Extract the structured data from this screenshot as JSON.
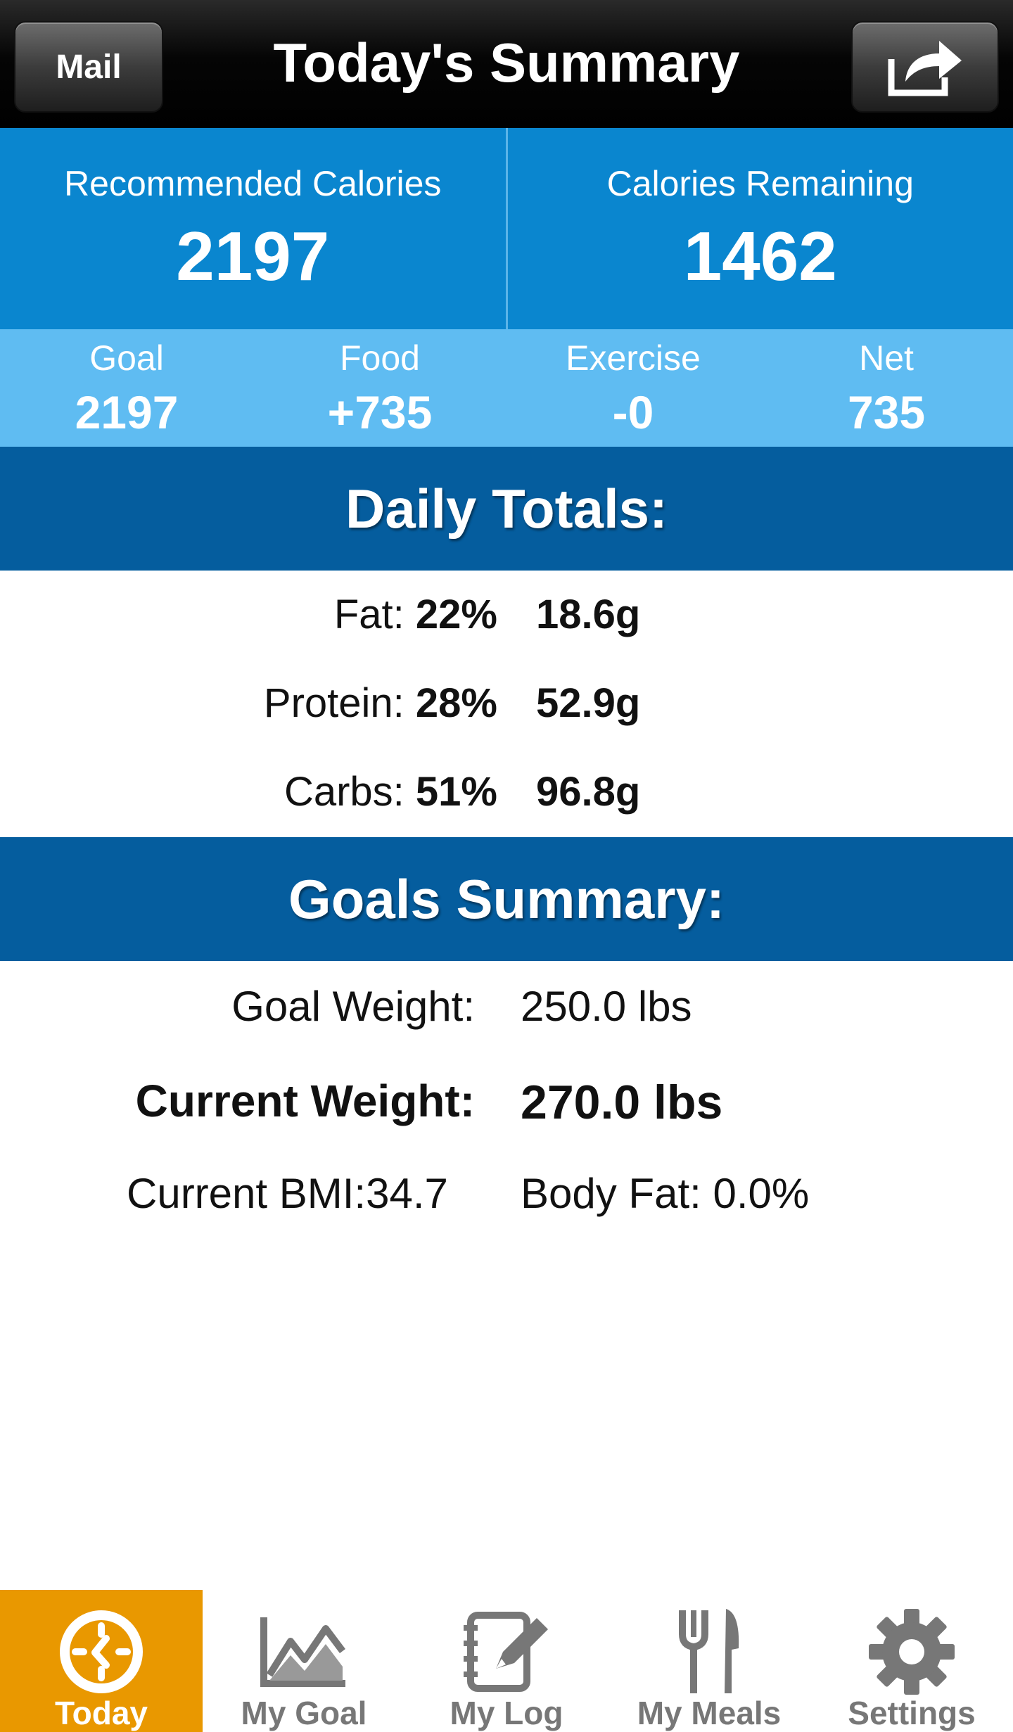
{
  "header": {
    "mail_label": "Mail",
    "title": "Today's Summary",
    "share_icon": "share-icon"
  },
  "calories": {
    "recommended_label": "Recommended Calories",
    "recommended_value": "2197",
    "remaining_label": "Calories Remaining",
    "remaining_value": "1462"
  },
  "breakdown": [
    {
      "label": "Goal",
      "value": "2197"
    },
    {
      "label": "Food",
      "value": "+735"
    },
    {
      "label": "Exercise",
      "value": "-0"
    },
    {
      "label": "Net",
      "value": "735"
    }
  ],
  "daily_totals": {
    "title": "Daily Totals:",
    "rows": [
      {
        "name": "Fat:",
        "percent": "22%",
        "grams": "18.6g"
      },
      {
        "name": "Protein:",
        "percent": "28%",
        "grams": "52.9g"
      },
      {
        "name": "Carbs:",
        "percent": "51%",
        "grams": "96.8g"
      }
    ]
  },
  "goals_summary": {
    "title": "Goals Summary:",
    "goal_weight_label": "Goal Weight:",
    "goal_weight_value": "250.0 lbs",
    "current_weight_label": "Current Weight:",
    "current_weight_value": "270.0 lbs",
    "bmi_text": "Current BMI:34.7",
    "body_fat_text": "Body Fat: 0.0%"
  },
  "tabs": [
    {
      "label": "Today",
      "icon": "clock-icon",
      "active": true
    },
    {
      "label": "My Goal",
      "icon": "chart-icon",
      "active": false
    },
    {
      "label": "My Log",
      "icon": "notepad-icon",
      "active": false
    },
    {
      "label": "My Meals",
      "icon": "fork-knife-icon",
      "active": false
    },
    {
      "label": "Settings",
      "icon": "gear-icon",
      "active": false
    }
  ],
  "colors": {
    "header_bg": "#000000",
    "calories_blue": "#0a86cf",
    "breakdown_light_blue": "#5fbcf2",
    "section_dark_blue": "#055d9e",
    "active_tab_orange": "#e99800"
  }
}
